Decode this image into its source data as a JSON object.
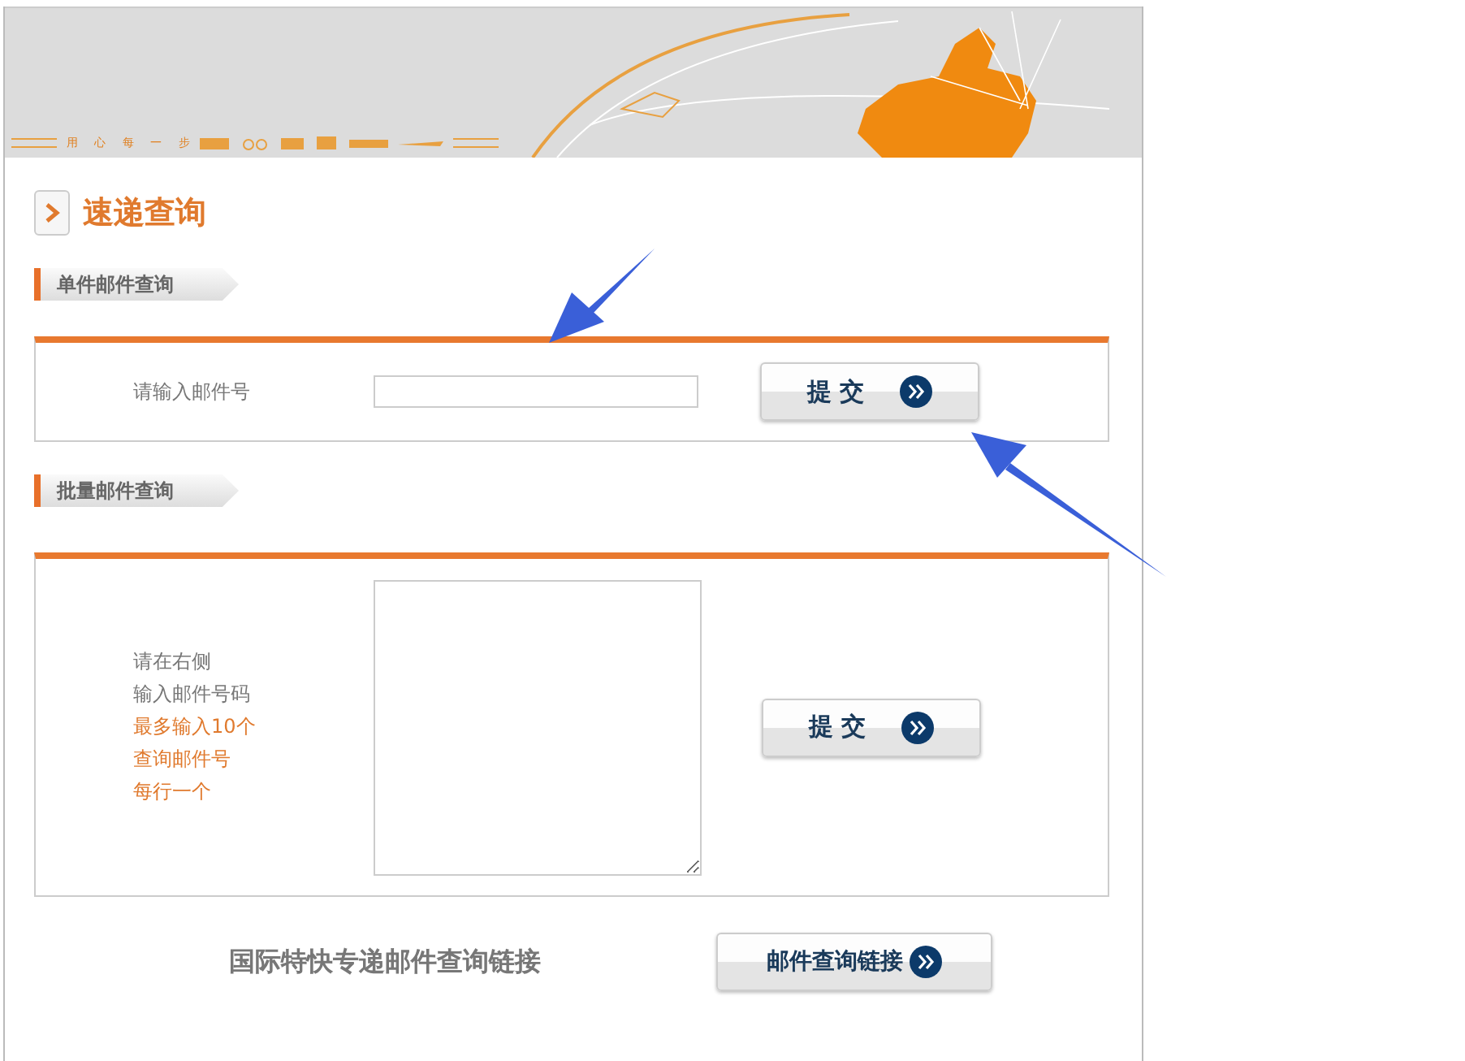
{
  "banner": {
    "slogan": "用 心 每 一 步"
  },
  "page_title": "速递查询",
  "single_query": {
    "section_label": "单件邮件查询",
    "field_label": "请输入邮件号",
    "submit_label": "提 交"
  },
  "batch_query": {
    "section_label": "批量邮件查询",
    "instructions": [
      {
        "text": "请在右侧",
        "kind": "plain"
      },
      {
        "text": "输入邮件号码",
        "kind": "plain"
      },
      {
        "text": "最多输入10个",
        "kind": "note"
      },
      {
        "text": "查询邮件号",
        "kind": "note"
      },
      {
        "text": "每行一个",
        "kind": "note"
      }
    ],
    "submit_label": "提 交"
  },
  "international": {
    "label": "国际特快专递邮件查询链接",
    "link_button": "邮件查询链接"
  }
}
